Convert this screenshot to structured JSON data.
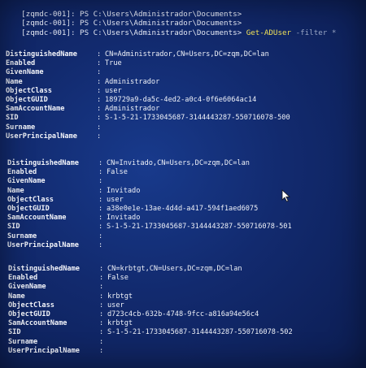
{
  "prompts": [
    {
      "text": "[zqmdc-001]: PS C:\\Users\\Administrador\\Documents>",
      "cmd": "",
      "arg": ""
    },
    {
      "text": "[zqmdc-001]: PS C:\\Users\\Administrador\\Documents>",
      "cmd": "",
      "arg": ""
    },
    {
      "text": "[zqmdc-001]: PS C:\\Users\\Administrador\\Documents> ",
      "cmd": "Get-ADUser",
      "arg": " -filter *"
    }
  ],
  "records": [
    {
      "rows": [
        {
          "key": "DistinguishedName",
          "value": "CN=Administrador,CN=Users,DC=zqm,DC=lan"
        },
        {
          "key": "Enabled",
          "value": "True"
        },
        {
          "key": "GivenName",
          "value": ""
        },
        {
          "key": "Name",
          "value": "Administrador"
        },
        {
          "key": "ObjectClass",
          "value": "user"
        },
        {
          "key": "ObjectGUID",
          "value": "189729a9-da5c-4ed2-a0c4-0f6e6064ac14"
        },
        {
          "key": "SamAccountName",
          "value": "Administrador"
        },
        {
          "key": "SID",
          "value": "S-1-5-21-1733045687-3144443287-550716078-500"
        },
        {
          "key": "Surname",
          "value": ""
        },
        {
          "key": "UserPrincipalName",
          "value": ""
        }
      ]
    },
    {
      "rows": [
        {
          "key": "DistinguishedName",
          "value": "CN=Invitado,CN=Users,DC=zqm,DC=lan"
        },
        {
          "key": "Enabled",
          "value": "False"
        },
        {
          "key": "GivenName",
          "value": ""
        },
        {
          "key": "Name",
          "value": "Invitado"
        },
        {
          "key": "ObjectClass",
          "value": "user"
        },
        {
          "key": "ObjectGUID",
          "value": "a38e0e1e-13ae-4d4d-a417-594f1aed6075"
        },
        {
          "key": "SamAccountName",
          "value": "Invitado"
        },
        {
          "key": "SID",
          "value": "S-1-5-21-1733045687-3144443287-550716078-501"
        },
        {
          "key": "Surname",
          "value": ""
        },
        {
          "key": "UserPrincipalName",
          "value": ""
        }
      ]
    },
    {
      "rows": [
        {
          "key": "DistinguishedName",
          "value": "CN=krbtgt,CN=Users,DC=zqm,DC=lan"
        },
        {
          "key": "Enabled",
          "value": "False"
        },
        {
          "key": "GivenName",
          "value": ""
        },
        {
          "key": "Name",
          "value": "krbtgt"
        },
        {
          "key": "ObjectClass",
          "value": "user"
        },
        {
          "key": "ObjectGUID",
          "value": "d723c4cb-632b-4748-9fcc-a816a94e56c4"
        },
        {
          "key": "SamAccountName",
          "value": "krbtgt"
        },
        {
          "key": "SID",
          "value": "S-1-5-21-1733045687-3144443287-550716078-502"
        },
        {
          "key": "Surname",
          "value": ""
        },
        {
          "key": "UserPrincipalName",
          "value": ""
        }
      ]
    }
  ],
  "separator": ":",
  "colors": {
    "background": "#122a6e",
    "command": "#f1e25a",
    "text": "#eef1f8"
  },
  "cursor_icon": "mouse-pointer-icon"
}
